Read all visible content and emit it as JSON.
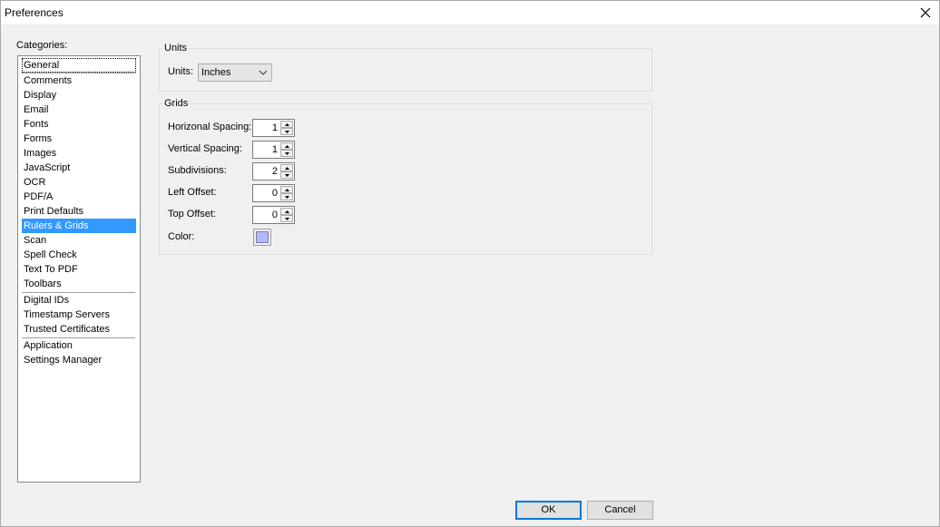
{
  "window": {
    "title": "Preferences"
  },
  "categories": {
    "label": "Categories:",
    "items": [
      "General",
      "Comments",
      "Display",
      "Email",
      "Fonts",
      "Forms",
      "Images",
      "JavaScript",
      "OCR",
      "PDF/A",
      "Print Defaults",
      "Rulers & Grids",
      "Scan",
      "Spell Check",
      "Text To PDF",
      "Toolbars",
      "Digital IDs",
      "Timestamp Servers",
      "Trusted Certificates",
      "Application",
      "Settings Manager"
    ],
    "selected": "Rulers & Grids"
  },
  "units": {
    "group_title": "Units",
    "label": "Units:",
    "value": "Inches"
  },
  "grids": {
    "group_title": "Grids",
    "horizontal_label": "Horizonal Spacing:",
    "horizontal_value": "1",
    "vertical_label": "Vertical Spacing:",
    "vertical_value": "1",
    "subdivisions_label": "Subdivisions:",
    "subdivisions_value": "2",
    "left_label": "Left Offset:",
    "left_value": "0",
    "top_label": "Top Offset:",
    "top_value": "0",
    "color_label": "Color:",
    "color_value": "#b3b9ff"
  },
  "buttons": {
    "ok": "OK",
    "cancel": "Cancel"
  },
  "colors": {
    "selection": "#3399ff",
    "ok_border": "#0078d7"
  }
}
